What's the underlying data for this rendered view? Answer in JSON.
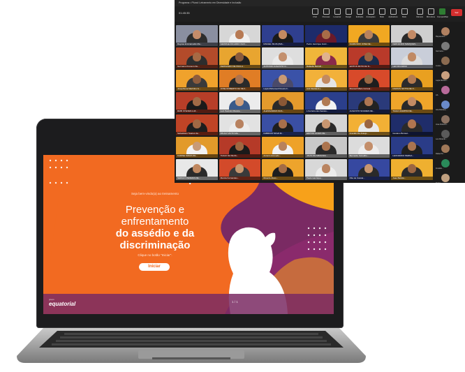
{
  "meeting": {
    "window_title": "Programa • Plural: Letramento em Diversidade e Inclusão",
    "timer": "01:45:35",
    "toolbar": [
      "Chat",
      "Pessoas",
      "Levantar",
      "Reagir",
      "Exibição",
      "Anotações",
      "Mais",
      "Aplicativos",
      "Mais"
    ],
    "right_tools": [
      "Câmera",
      "Microfone",
      "Compartilhar",
      "Sair"
    ],
    "tiles": [
      {
        "name": "Rayssa Emmanuelle Ma...",
        "bg": "#8a8fa0",
        "skin": "#c58c6a",
        "shirt": "#2d2d2d"
      },
      {
        "name": "GEORGE RICARDO OLIV...",
        "bg": "#d7d7d7",
        "skin": "#b77a54",
        "shirt": "#f0f0f0"
      },
      {
        "name": "RAFAEL SILVA (IMA...",
        "bg": "#2f3f8f",
        "skin": "#c48a60",
        "shirt": "#1a1a1a"
      },
      {
        "name": "Pedro Henrique Guim...",
        "bg": "#1d2b6b",
        "skin": "#a86c48",
        "shirt": "#6b1a2a"
      },
      {
        "name": "RAIMUNDO JOSE DE...",
        "bg": "#f1a822",
        "skin": "#b8825d",
        "shirt": "#3a3a3a"
      },
      {
        "name": "FERNANDO MARQUES...",
        "bg": "#cfcfcf",
        "skin": "#c48b66",
        "shirt": "#2a2a2a"
      },
      {
        "name": "Germano Kreneco De...",
        "bg": "#b34b2a",
        "skin": "#a76a44",
        "shirt": "#2d2d2d"
      },
      {
        "name": "FERNANDO DE PAULA...",
        "bg": "#e8a530",
        "skin": "#8a5a3a",
        "shirt": "#1f1f1f"
      },
      {
        "name": "ANTONIO AUGUSTO O...",
        "bg": "#dedede",
        "skin": "#c3906e",
        "shirt": "#eaeaea"
      },
      {
        "name": "Rafaella Bertelli...",
        "bg": "#f0b63a",
        "skin": "#e0b28d",
        "shirt": "#8a2a4a"
      },
      {
        "name": "EDITON MOTA DA N...",
        "bg": "#b93a2a",
        "skin": "#9a6240",
        "shirt": "#1a2a4a"
      },
      {
        "name": "LEO RICARDO",
        "bg": "#c9ced9",
        "skin": "#c08a64",
        "shirt": "#dcdcdc"
      },
      {
        "name": "Josephlena Martinho G...",
        "bg": "#f0a22c",
        "skin": "#8f5c3c",
        "shirt": "#3a3a3a"
      },
      {
        "name": "JOSE ROBERTO DA SILV...",
        "bg": "#e07d25",
        "skin": "#ad724c",
        "shirt": "#2a2a2a"
      },
      {
        "name": "Layla Mohamed Pereira F...",
        "bg": "#3a52a8",
        "skin": "#c99a74",
        "shirt": "#4a4a6a"
      },
      {
        "name": "Anti Maddenti (...",
        "bg": "#f2b13a",
        "skin": "#c28a60",
        "shirt": "#e5e5e5"
      },
      {
        "name": "Maxwell Mielo Correia...",
        "bg": "#d84a2a",
        "skin": "#9c6642",
        "shirt": "#1e1e1e"
      },
      {
        "name": "DAMIUS NOTTA DE O...",
        "bg": "#e9a020",
        "skin": "#b47a50",
        "shirt": "#2b2b2b"
      },
      {
        "name": "RUBI STEVES LUZ...",
        "bg": "#b73e28",
        "skin": "#a06a46",
        "shirt": "#1a1a1a"
      },
      {
        "name": "Luiz Pedrolo Oliveira...",
        "bg": "#ececec",
        "skin": "#d4a27c",
        "shirt": "#3a5a8a"
      },
      {
        "name": "ALESSANDRA SOA...",
        "bg": "#e49a2c",
        "skin": "#8a5836",
        "shirt": "#2a2a2a"
      },
      {
        "name": "L Ferreira dos Santos...",
        "bg": "#2b3f8c",
        "skin": "#b07a52",
        "shirt": "#f2f2f2"
      },
      {
        "name": "AUGUSTO SOARES DE...",
        "bg": "#2a3a7a",
        "skin": "#ae7652",
        "shirt": "#222222"
      },
      {
        "name": "TIAGO ZAMPINI DE...",
        "bg": "#efa52a",
        "skin": "#c48c64",
        "shirt": "#2a2a2a"
      },
      {
        "name": "Sebastiano Soares da...",
        "bg": "#c04426",
        "skin": "#a06844",
        "shirt": "#1e1e1e"
      },
      {
        "name": "PAULO VICTO MA...",
        "bg": "#e2e2e2",
        "skin": "#b88260",
        "shirt": "#ececec"
      },
      {
        "name": "FABRICIO SILVA M...",
        "bg": "#3a4fa4",
        "skin": "#a8704a",
        "shirt": "#1e1e1e"
      },
      {
        "name": "EDITON ALVES DE...",
        "bg": "#d5d5d5",
        "skin": "#c89670",
        "shirt": "#2a2a2a"
      },
      {
        "name": "Franklin De Araujo...",
        "bg": "#f2b035",
        "skin": "#9a6440",
        "shirt": "#e9e9e9"
      },
      {
        "name": "Gustavo Bonsal...",
        "bg": "#1f2d6a",
        "skin": "#b07650",
        "shirt": "#2a2a2a"
      },
      {
        "name": "KARINE MARIA DE...",
        "bg": "#e29a2a",
        "skin": "#c89a76",
        "shirt": "#f2f2f2"
      },
      {
        "name": "TIAGO DA SILVA...",
        "bg": "#b53a28",
        "skin": "#9e6640",
        "shirt": "#1a1a1a"
      },
      {
        "name": "Antonio Azevedo...",
        "bg": "#eea228",
        "skin": "#b8825c",
        "shirt": "#f2f2f2"
      },
      {
        "name": "JAIAS DE MIRANDA...",
        "bg": "#c8c8c8",
        "skin": "#ab744e",
        "shirt": "#2a2a2a"
      },
      {
        "name": "Bernardo Carvalho...",
        "bg": "#dcdcdc",
        "skin": "#c38e6a",
        "shirt": "#ededed"
      },
      {
        "name": "LEONARDO PERNA...",
        "bg": "#2a3c88",
        "skin": "#aa7450",
        "shirt": "#1f1f1f"
      },
      {
        "name": "SERGIO PEREIRA DE...",
        "bg": "#e8e8e8",
        "skin": "#c08860",
        "shirt": "#2b2b2b"
      },
      {
        "name": "Marcia Fernandes...",
        "bg": "#d34a2a",
        "skin": "#c9966e",
        "shirt": "#3a3a3a"
      },
      {
        "name": "Ricardo Alves...",
        "bg": "#eda42c",
        "skin": "#a36c46",
        "shirt": "#1e1e1e"
      },
      {
        "name": "Paulo Henrique...",
        "bg": "#d8d8d8",
        "skin": "#b98460",
        "shirt": "#ececec"
      },
      {
        "name": "Rita de Cassia...",
        "bg": "#3648a0",
        "skin": "#c89670",
        "shirt": "#2a2a2a"
      },
      {
        "name": "Joao Batista...",
        "bg": "#efb030",
        "skin": "#9c6642",
        "shirt": "#2a2a2a"
      }
    ],
    "sidebar": [
      {
        "name": "Rayssa Em...",
        "color": "#b08060"
      },
      {
        "name": "Germano...",
        "color": "#7a7a7a"
      },
      {
        "name": "Lucas...",
        "color": "#8a6a50"
      },
      {
        "name": "Layla Moham...",
        "color": "#c8a080"
      },
      {
        "name": "AA",
        "color": "#b86a9a"
      },
      {
        "name": "Ana Rebeka...",
        "color": "#6a8ac8"
      },
      {
        "name": "Jose Roberto...",
        "color": "#8a7060"
      },
      {
        "name": "Leo Ricardo...",
        "color": "#5a5a5a"
      },
      {
        "name": "Rafael M...",
        "color": "#a07858"
      },
      {
        "name": "Franklin...",
        "color": "#2a8a5a"
      },
      {
        "name": "Pedro...",
        "color": "#c0a080"
      }
    ]
  },
  "slide": {
    "logo_prefix": "+",
    "logo_word": "plural",
    "welcome": "Seja bem-vindo(a) ao treinamento",
    "title_line1": "Prevenção e",
    "title_line2": "enfrentamento",
    "title_line3": "do assédio e da",
    "title_line4": "discriminação",
    "hint": "Clique no botão \"Iniciar\".",
    "start_button": "Iniciar",
    "brand_small": "grupo",
    "brand": "equatorial",
    "page": "1 / 1"
  },
  "colors": {
    "slide_purple": "#7a2a63",
    "slide_orange": "#f26a21",
    "slide_yellow": "#f7a11a",
    "meeting_bg": "#1b1b1b"
  }
}
